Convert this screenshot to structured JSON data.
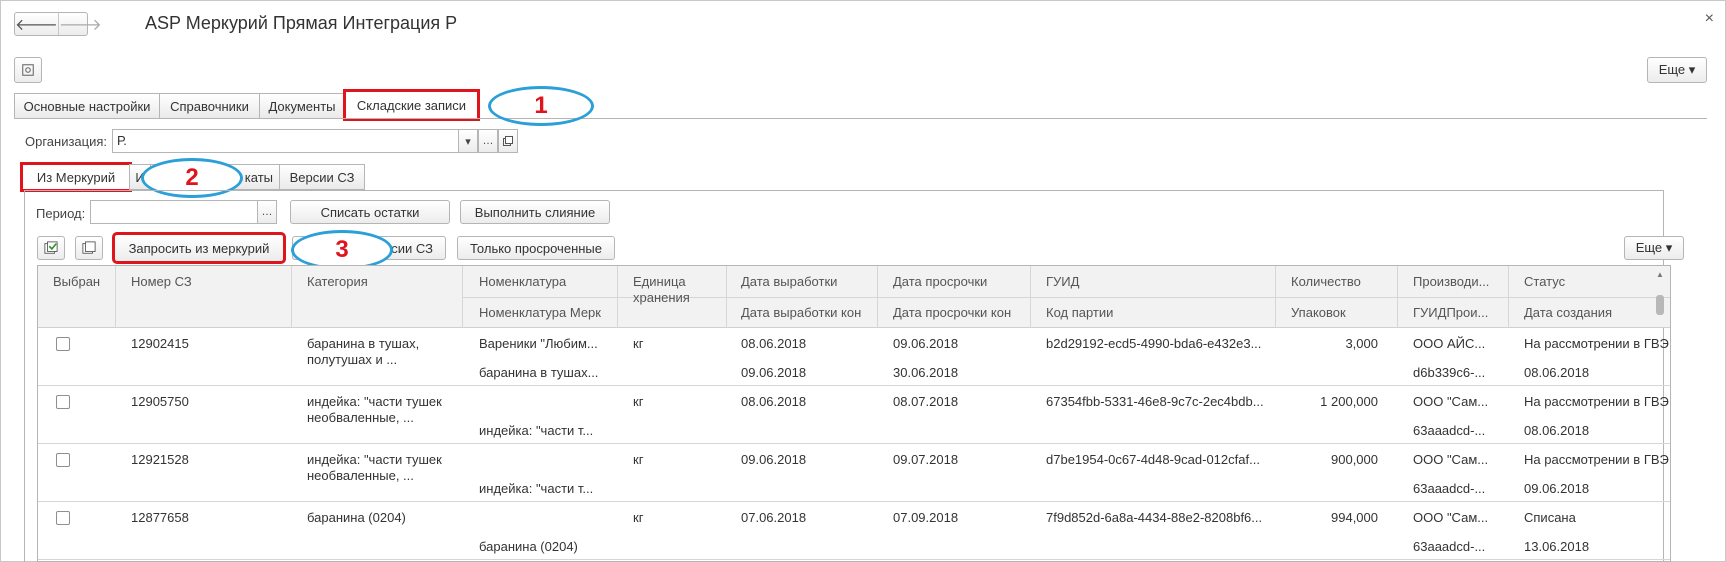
{
  "window": {
    "title": "ASP Меркурий Прямая Интеграция Р",
    "close": "×"
  },
  "nav": {
    "back": "🡐",
    "forward": "🡒"
  },
  "toolbar": {
    "more_label": "Еще ▾"
  },
  "tabs": [
    {
      "label": "Основные настройки"
    },
    {
      "label": "Справочники"
    },
    {
      "label": "Документы"
    },
    {
      "label": "Складские записи"
    }
  ],
  "org": {
    "label": "Организация:",
    "value": "Р."
  },
  "subtabs": [
    {
      "label": "Из Меркурий"
    },
    {
      "label": "И"
    },
    {
      "label": "каты"
    },
    {
      "label": "Версии СЗ"
    }
  ],
  "period": {
    "label": "Период:",
    "value": ""
  },
  "buttons": {
    "write_off": "Списать остатки",
    "merge": "Выполнить слияние",
    "request": "Запросить из меркурий",
    "versions": "сии СЗ",
    "overdue": "Только просроченные",
    "more": "Еще ▾"
  },
  "callouts": [
    "1",
    "2",
    "3"
  ],
  "table": {
    "headers": {
      "selected": "Выбран",
      "number": "Номер СЗ",
      "category": "Категория",
      "nomen": "Номенклатура",
      "nomen2": "Номенклатура Мерк",
      "unit": "Единица хранения",
      "prod_date": "Дата выработки",
      "prod_date2": "Дата выработки кон",
      "exp_date": "Дата просрочки",
      "exp_date2": "Дата просрочки кон",
      "guid": "ГУИД",
      "batch": "Код партии",
      "qty": "Количество",
      "packs": "Упаковок",
      "producer": "Производи...",
      "producer2": "ГУИДПрои...",
      "status": "Статус",
      "created": "Дата создания"
    },
    "rows": [
      {
        "number": "12902415",
        "category": "баранина в тушах, полутушах и ...",
        "nomen": "Вареники \"Любим...",
        "nomen2": "баранина в тушах...",
        "unit": "кг",
        "prod_date": "08.06.2018",
        "prod_date2": "09.06.2018",
        "exp_date": "09.06.2018",
        "exp_date2": "30.06.2018",
        "guid": "b2d29192-ecd5-4990-bda6-e432e3...",
        "batch": "",
        "qty": "3,000",
        "producer": "ООО АЙС...",
        "producer2": "d6b339c6-...",
        "status": "На рассмотрении в ГВЭ",
        "created": "08.06.2018"
      },
      {
        "number": "12905750",
        "category": "индейка: \"части тушек необваленные, ...",
        "nomen": "",
        "nomen2": "индейка: \"части т...",
        "unit": "кг",
        "prod_date": "08.06.2018",
        "prod_date2": "",
        "exp_date": "08.07.2018",
        "exp_date2": "",
        "guid": "67354fbb-5331-46e8-9c7c-2ec4bdb...",
        "batch": "",
        "qty": "1 200,000",
        "producer": "ООО \"Сам...",
        "producer2": "63aaadcd-...",
        "status": "На рассмотрении в ГВЭ",
        "created": "08.06.2018"
      },
      {
        "number": "12921528",
        "category": "индейка: \"части тушек необваленные, ...",
        "nomen": "",
        "nomen2": "индейка: \"части т...",
        "unit": "кг",
        "prod_date": "09.06.2018",
        "prod_date2": "",
        "exp_date": "09.07.2018",
        "exp_date2": "",
        "guid": "d7be1954-0c67-4d48-9cad-012cfaf...",
        "batch": "",
        "qty": "900,000",
        "producer": "ООО \"Сам...",
        "producer2": "63aaadcd-...",
        "status": "На рассмотрении в ГВЭ",
        "created": "09.06.2018"
      },
      {
        "number": "12877658",
        "category": "баранина (0204)",
        "nomen": "",
        "nomen2": "баранина (0204)",
        "unit": "кг",
        "prod_date": "07.06.2018",
        "prod_date2": "",
        "exp_date": "07.09.2018",
        "exp_date2": "",
        "guid": "7f9d852d-6a8a-4434-88e2-8208bf6...",
        "batch": "",
        "qty": "994,000",
        "producer": "ООО \"Сам...",
        "producer2": "63aaadcd-...",
        "status": "Списана",
        "created": "13.06.2018"
      }
    ]
  }
}
